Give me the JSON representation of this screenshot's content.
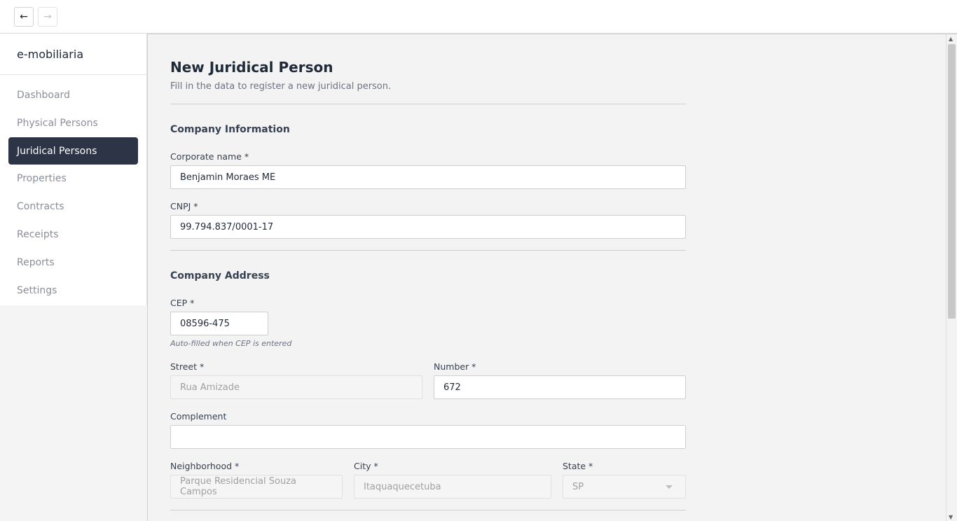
{
  "nav": {
    "back_glyph": "←",
    "forward_glyph": "→"
  },
  "sidebar": {
    "brand": "e-mobiliaria",
    "items": [
      {
        "label": "Dashboard"
      },
      {
        "label": "Physical Persons"
      },
      {
        "label": "Juridical Persons",
        "active": true
      },
      {
        "label": "Properties"
      },
      {
        "label": "Contracts"
      },
      {
        "label": "Receipts"
      },
      {
        "label": "Reports"
      },
      {
        "label": "Settings"
      }
    ]
  },
  "page": {
    "title": "New Juridical Person",
    "subtitle": "Fill in the data to register a new juridical person."
  },
  "company_info": {
    "title": "Company Information",
    "corporate_name_label": "Corporate name *",
    "corporate_name_value": "Benjamin Moraes ME",
    "cnpj_label": "CNPJ *",
    "cnpj_value": "99.794.837/0001-17"
  },
  "company_address": {
    "title": "Company Address",
    "cep_label": "CEP *",
    "cep_value": "08596-475",
    "cep_hint": "Auto-filled when CEP is entered",
    "street_label": "Street *",
    "street_value": "Rua Amizade",
    "number_label": "Number *",
    "number_value": "672",
    "complement_label": "Complement",
    "complement_value": "",
    "neighborhood_label": "Neighborhood *",
    "neighborhood_value": "Parque Residencial Souza Campos",
    "city_label": "City *",
    "city_value": "Itaquaquecetuba",
    "state_label": "State *",
    "state_value": "SP"
  },
  "colors": {
    "sidebar_active_bg": "#2c3446",
    "page_bg": "#f3f3f3"
  }
}
